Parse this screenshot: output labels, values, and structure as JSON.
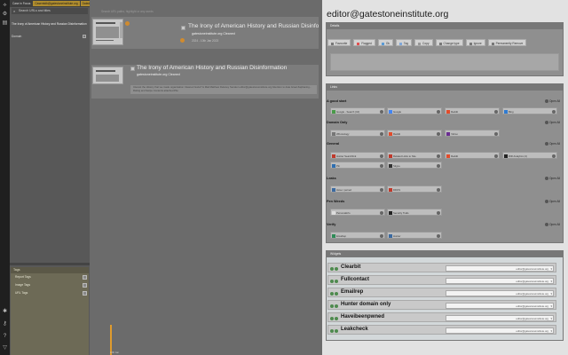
{
  "app": {
    "accent": "#b08d2e"
  },
  "rail": {
    "icons": [
      "graph-icon",
      "gear-icon",
      "notes-icon",
      "settings-icon",
      "key-icon",
      "help-icon",
      "logo-icon"
    ]
  },
  "sidebar": {
    "tabs": [
      {
        "label": "Case in Focus",
        "active": false
      },
      {
        "label": "Casemtdb@gatestoneinstitute.org",
        "active": true
      },
      {
        "label": "Dated Typo/Cnd Sidebar",
        "active": true
      }
    ],
    "search_placeholder": "Search URLs and titles",
    "selected_caption": "The Irony of American History and Russian Disinformation",
    "domain_row": "Domain",
    "tags": {
      "header": "Tags",
      "items": [
        "Report Tags",
        "Image Tags",
        "URL Tags"
      ]
    }
  },
  "main": {
    "filter_hint": "Search URL paths, highlight or any words",
    "cards": [
      {
        "title": "The Irony of American History and Russian Disinfo",
        "domain": "gatestoneinstitute.org Cleaned",
        "date": "2024 - 10th Jan 2023"
      },
      {
        "title": "The Irony of American History and Russian Disinformation",
        "domain": "gatestoneinstitute.org Cleaned",
        "annotation": "Interest the History that we made organisation Cleaned Gaza? & Mail Matthew Delaney Senator editor@gatestoneinstitute.org Attention to date Israel Zaphaning... Rating and Swipe Contents attached Pile"
      }
    ],
    "timeline_label": "10th Jan"
  },
  "panel": {
    "title": "editor@gatestoneinstitute.org",
    "details_header": "Details",
    "actions": [
      {
        "label": "Favourite",
        "color": "#777777"
      },
      {
        "label": "Flagged",
        "color": "#e05050"
      },
      {
        "label": "Ok",
        "color": "#5b9bd5"
      },
      {
        "label": "Tag",
        "color": "#7fa7d9"
      },
      {
        "label": "Copy",
        "color": "#999999"
      },
      {
        "label": "Change type",
        "color": "#777777"
      },
      {
        "label": "Ignore",
        "color": "#777777"
      },
      {
        "label": "Permanently Remove",
        "color": "#777777"
      }
    ],
    "links_header": "Links",
    "open_all": "Open All",
    "groups": [
      {
        "name": "A good start",
        "links": [
          {
            "label": "Google - Search (10)",
            "color": "#4a9a4a"
          },
          {
            "label": "Google",
            "color": "#4285f4"
          },
          {
            "label": "Reddit",
            "color": "#e24c2b"
          },
          {
            "label": "Bing",
            "color": "#2f7bd1"
          }
        ]
      },
      {
        "name": "Domain Only",
        "links": [
          {
            "label": "Whoisology",
            "color": "#777777"
          },
          {
            "label": "Reddit",
            "color": "#e24c2b"
          },
          {
            "label": "Yahoo",
            "color": "#6a2d91"
          }
        ]
      },
      {
        "name": "General",
        "links": [
          {
            "label": "Hunter Searchlink",
            "color": "#c0392b"
          },
          {
            "label": "Related Links to Site",
            "color": "#c0392b"
          },
          {
            "label": "Reddit",
            "color": "#e24c2b"
          },
          {
            "label": "RIR Analytics (4)",
            "color": "#222222"
          },
          {
            "label": "Pin",
            "color": "#2f6fb0"
          },
          {
            "label": "Skype",
            "color": "#333333"
          }
        ]
      },
      {
        "name": "Leaks",
        "links": [
          {
            "label": "Have i pwned",
            "color": "#3b6aa0"
          },
          {
            "label": "DDOS",
            "color": "#c0392b"
          }
        ]
      },
      {
        "name": "Pen Weeds",
        "links": [
          {
            "label": "Personalinfo",
            "color": "#dddddd"
          },
          {
            "label": "Security Trails",
            "color": "#222222"
          }
        ]
      },
      {
        "name": "Verify",
        "links": [
          {
            "label": "Emailrep",
            "color": "#2e8b57"
          },
          {
            "label": "Hunter",
            "color": "#3b6aa0"
          }
        ]
      }
    ],
    "widgets_header": "Widgets",
    "widgets": [
      {
        "name": "Clearbit",
        "value": "editor@gatestoneinstitute.org"
      },
      {
        "name": "Fullcontact",
        "value": "editor@gatestoneinstitute.org"
      },
      {
        "name": "Emailrep",
        "value": "editor@gatestoneinstitute.org"
      },
      {
        "name": "Hunter domain only",
        "value": "editor@gatestoneinstitute.org"
      },
      {
        "name": "Haveibeenpwned",
        "value": "editor@gatestoneinstitute.org"
      },
      {
        "name": "Leakcheck",
        "value": "editor@gatestoneinstitute.org"
      }
    ]
  }
}
